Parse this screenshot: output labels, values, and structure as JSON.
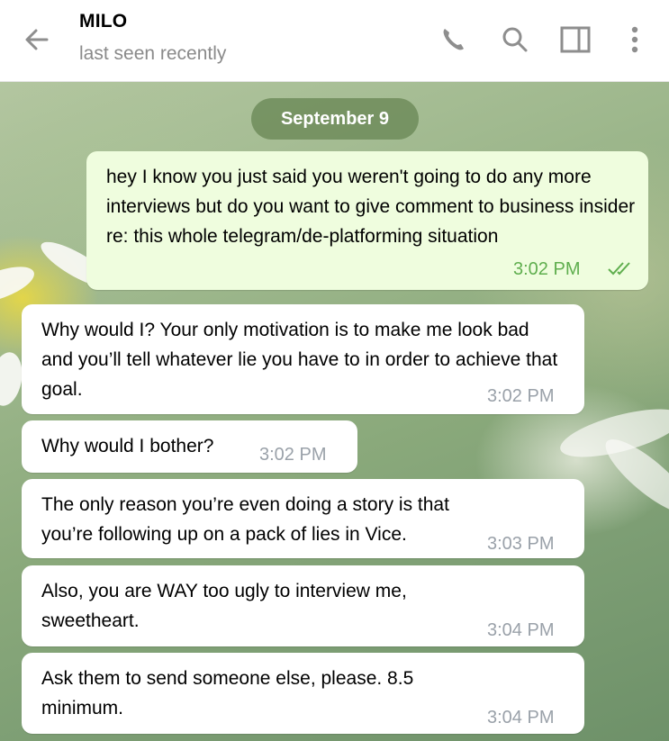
{
  "header": {
    "contact_name": "MILO",
    "status": "last seen recently",
    "icons": [
      "back-arrow-icon",
      "phone-icon",
      "search-icon",
      "sidebar-icon",
      "more-vertical-icon"
    ]
  },
  "chat": {
    "date_label": "September 9",
    "messages": [
      {
        "direction": "outgoing",
        "text": "hey I know you just said you weren't going to do any more interviews but do you want to give comment to business insider re: this whole telegram/de-platforming situation",
        "time": "3:02 PM",
        "read": true
      },
      {
        "direction": "incoming",
        "text": "Why would I? Your only motivation is to make me look bad and you’ll tell whatever lie you have to in order to achieve that goal.",
        "time": "3:02 PM"
      },
      {
        "direction": "incoming",
        "text": "Why would I bother?",
        "time": "3:02 PM"
      },
      {
        "direction": "incoming",
        "text": "The only reason you’re even doing a story is that you’re following up on a pack of lies in Vice.",
        "time": "3:03 PM"
      },
      {
        "direction": "incoming",
        "text": "Also, you are WAY too ugly to interview me, sweetheart.",
        "time": "3:04 PM"
      },
      {
        "direction": "incoming",
        "text": "Ask them to send someone else, please. 8.5 minimum.",
        "time": "3:04 PM"
      }
    ]
  },
  "colors": {
    "outgoing_bubble": "#effdde",
    "incoming_bubble": "#ffffff",
    "outgoing_time": "#5fae4e",
    "incoming_time": "#9aa1a9",
    "date_pill": "#6e8c5a"
  }
}
